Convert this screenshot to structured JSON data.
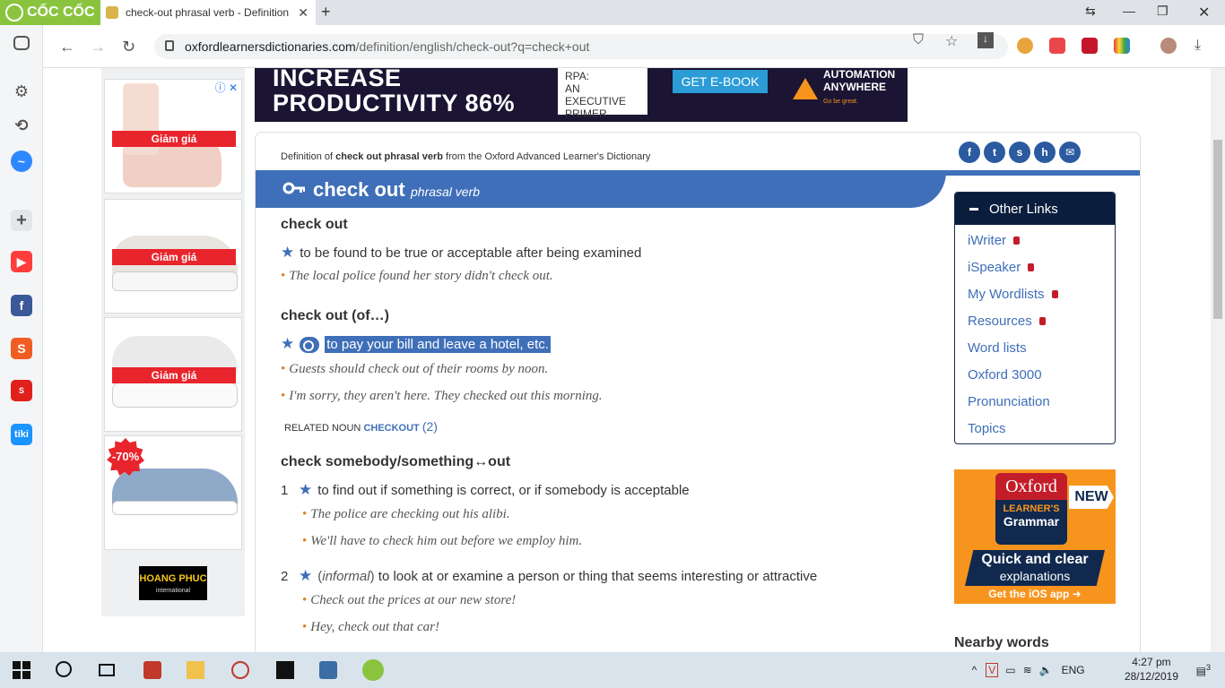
{
  "browser": {
    "brand": "CỐC CỐC",
    "tab_title": "check-out phrasal verb - Definition",
    "url_domain": "oxfordlearnersdictionaries.com",
    "url_path": "/definition/english/check-out?q=check+out"
  },
  "banner": {
    "line1": "INCREASE",
    "line2": "PRODUCTIVITY 86%",
    "rpa": [
      "RPA:",
      "AN EXECUTIVE",
      "PRIMER"
    ],
    "cta": "GET E-BOOK",
    "brand1": "AUTOMATION",
    "brand2": "ANYWHERE",
    "brand3": "Go be great."
  },
  "ads": {
    "sale_label": "Giảm giá",
    "discount": "-70%",
    "hoangphuc": "HOANG PHUC",
    "hoangphuc_sub": "international"
  },
  "article": {
    "def_of_prefix": "Definition of ",
    "def_of_word": "check out phrasal verb",
    "def_of_suffix": " from the Oxford Advanced Learner's Dictionary",
    "headword": "check out",
    "pos": "phrasal verb",
    "s1_head": "check out",
    "s1_def": "to be found to be true or acceptable after being examined",
    "s1_ex": "The local police found her story didn't check out.",
    "s2_head": "check out (of…)",
    "s2_def": "to pay your bill and leave a hotel, etc.",
    "s2_ex1": "Guests should check out of their rooms by noon.",
    "s2_ex2": "I'm sorry, they aren't here. They checked out this morning.",
    "related_label": "RELATED NOUN",
    "related_word": "CHECKOUT",
    "related_count": "(2)",
    "s3_head": "check somebody/something↔out",
    "s3_n1": "1",
    "s3_def1": "to find out if something is correct, or if somebody is acceptable",
    "s3_ex1": "The police are checking out his alibi.",
    "s3_ex2": "We'll have to check him out before we employ him.",
    "s3_n2": "2",
    "s3_def2_reg": "informal",
    "s3_def2_open": "(",
    "s3_def2_close": ")",
    "s3_def2": " to look at or examine a person or thing that seems interesting or attractive",
    "s3_ex3": "Check out the prices at our new store!",
    "s3_ex4": "Hey, check out that car!"
  },
  "other_links": {
    "title": "Other Links",
    "items": [
      "iWriter",
      "iSpeaker",
      "My Wordlists",
      "Resources",
      "Word lists",
      "Oxford 3000",
      "Pronunciation",
      "Topics"
    ]
  },
  "grammar_ad": {
    "oxford": "Oxford",
    "learners": "LEARNER'S",
    "grammar": "Grammar",
    "new": "NEW",
    "quick": "Quick and clear",
    "explanations": "explanations",
    "ios": "Get the iOS app"
  },
  "nearby": "Nearby words",
  "taskbar": {
    "lang": "ENG",
    "time": "4:27 pm",
    "date": "28/12/2019",
    "notif": "3"
  },
  "social_icons": [
    "facebook-icon",
    "twitter-icon",
    "stumbleupon-icon",
    "hi5-icon",
    "email-icon"
  ]
}
